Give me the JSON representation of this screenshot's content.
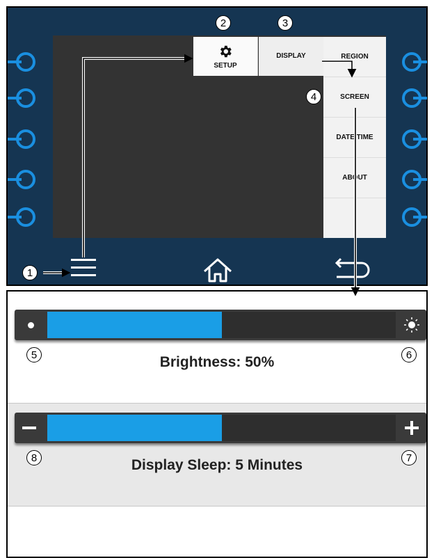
{
  "device": {
    "menu": {
      "setup_label": "SETUP",
      "display_label": "DISPLAY",
      "submenu": [
        "REGION",
        "SCREEN",
        "DATE TIME",
        "ABOUT"
      ]
    },
    "nav": {
      "menu_icon": "hamburger-menu-icon",
      "home_icon": "home-icon",
      "back_icon": "back-icon"
    }
  },
  "callouts": [
    "1",
    "2",
    "3",
    "4",
    "5",
    "6",
    "7",
    "8"
  ],
  "brightness": {
    "label": "Brightness: 50%",
    "level": 0.5,
    "left_icon": "dim-dot-icon",
    "right_icon": "sun-icon"
  },
  "display_sleep": {
    "label": "Display Sleep: 5 Minutes",
    "level": 0.5,
    "left_icon": "minus-icon",
    "right_icon": "plus-icon"
  },
  "colors": {
    "device_bg": "#153552",
    "accent": "#1a9ee6",
    "connector": "#1a8fe0",
    "screen": "#333333"
  }
}
